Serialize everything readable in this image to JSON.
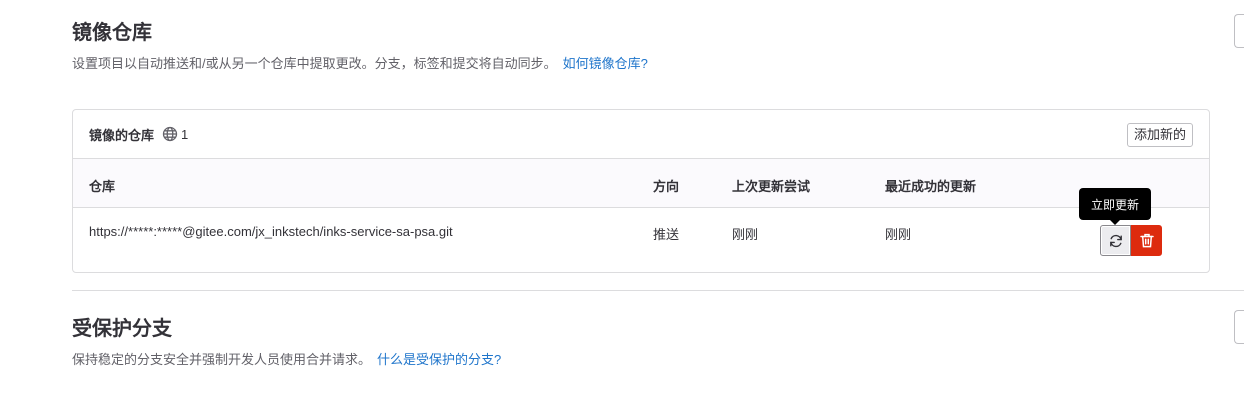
{
  "mirror_section": {
    "title": "镜像仓库",
    "description": "设置项目以自动推送和/或从另一个仓库中提取更改。分支，标签和提交将自动同步。",
    "help_link": "如何镜像仓库?"
  },
  "mirrors_card": {
    "title": "镜像的仓库",
    "count": "1",
    "add_button": "添加新的",
    "columns": [
      "仓库",
      "方向",
      "上次更新尝试",
      "最近成功的更新"
    ],
    "rows": [
      {
        "url": "https://*****:*****@gitee.com/jx_inkstech/inks-service-sa-psa.git",
        "direction": "推送",
        "last_attempt": "刚刚",
        "last_success": "刚刚"
      }
    ],
    "tooltip": "立即更新",
    "sync_icon": "sync-icon",
    "delete_icon": "trash-icon",
    "delete_color": "#dd2b0e"
  },
  "protected_section": {
    "title": "受保护分支",
    "description": "保持稳定的分支安全并强制开发人员使用合并请求。",
    "help_link": "什么是受保护的分支?"
  },
  "colors": {
    "link": "#1f75cb",
    "tooltip_bg": "#000000"
  }
}
